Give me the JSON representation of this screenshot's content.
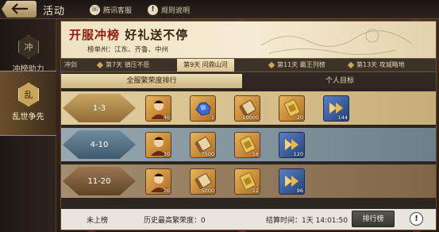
{
  "topbar": {
    "title": "活动",
    "service_label": "腾讯客服",
    "service_icon": "headset-icon",
    "rules_label": "规则说明",
    "rules_icon": "info-icon"
  },
  "sidebar": {
    "items": [
      {
        "label": "冲榜助力",
        "badge": "冲",
        "active": false
      },
      {
        "label": "乱世争先",
        "badge": "乱",
        "active": true
      }
    ]
  },
  "banner": {
    "title_a": "开服冲榜",
    "title_b": "好礼送不停",
    "subtitle": "榜单州：江东、齐鲁、中州"
  },
  "stages": [
    {
      "label": "冲剑",
      "active": false
    },
    {
      "label": "第7天  镇压不臣",
      "active": false
    },
    {
      "label": "第9天  问鼎山河",
      "active": true
    },
    {
      "label": "第11天  霸王列榜",
      "active": false
    },
    {
      "label": "第13天  攻城略地",
      "active": false
    }
  ],
  "rank_tabs": {
    "server": "全服繁荣度排行",
    "personal": "个人目标"
  },
  "tiers": [
    {
      "rank": "1-3",
      "items": [
        {
          "icon": "general-portrait-icon",
          "count": "40"
        },
        {
          "icon": "blue-ore-icon",
          "count": "1"
        },
        {
          "icon": "scroll-icon",
          "count": "10000"
        },
        {
          "icon": "golden-token-icon",
          "count": "20"
        },
        {
          "icon": "speedup-arrow-icon",
          "count": "144"
        }
      ]
    },
    {
      "rank": "4-10",
      "items": [
        {
          "icon": "general-portrait-icon",
          "count": "30"
        },
        {
          "icon": "scroll-icon",
          "count": "7500"
        },
        {
          "icon": "golden-token-icon",
          "count": "16"
        },
        {
          "icon": "speedup-arrow-icon",
          "count": "120"
        }
      ]
    },
    {
      "rank": "11-20",
      "items": [
        {
          "icon": "general-portrait-icon",
          "count": "20"
        },
        {
          "icon": "scroll-icon",
          "count": "5000"
        },
        {
          "icon": "golden-token-icon",
          "count": "12"
        },
        {
          "icon": "speedup-arrow-icon",
          "count": "96"
        }
      ]
    }
  ],
  "bottom": {
    "status": "未上榜",
    "history_label": "历史最高繁荣度：0",
    "countdown_label": "结算时间：1天  14:01:50",
    "leaderboard_button": "排行榜",
    "help_label": "!"
  }
}
